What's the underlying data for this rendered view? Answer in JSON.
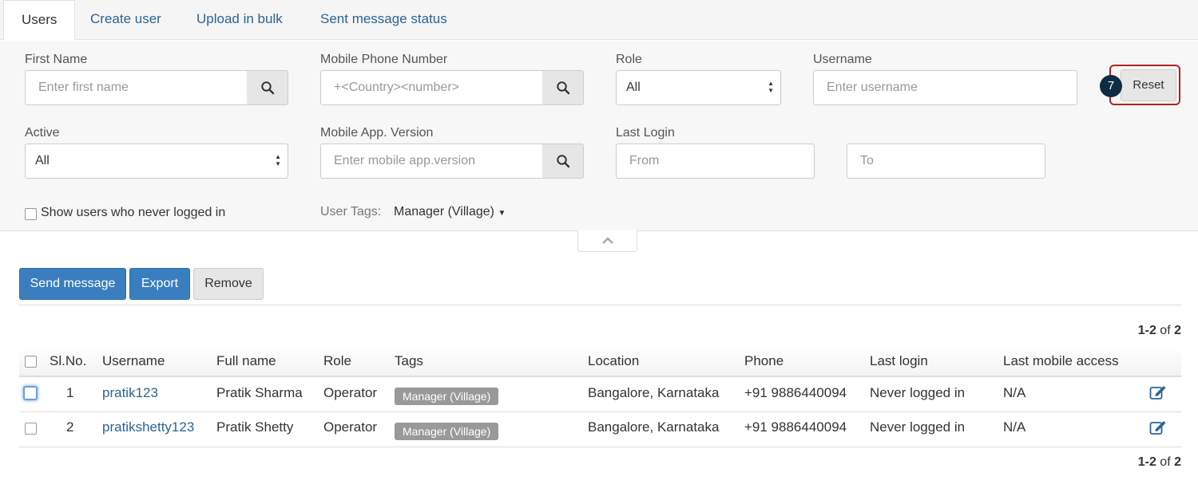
{
  "tabs": [
    {
      "label": "Users",
      "active": true
    },
    {
      "label": "Create user",
      "active": false
    },
    {
      "label": "Upload in bulk",
      "active": false
    },
    {
      "label": "Sent message status",
      "active": false
    }
  ],
  "filters": {
    "first_name": {
      "label": "First Name",
      "placeholder": "Enter first name"
    },
    "mobile_phone": {
      "label": "Mobile Phone Number",
      "placeholder": "+<Country><number>"
    },
    "role": {
      "label": "Role",
      "value": "All"
    },
    "username": {
      "label": "Username",
      "placeholder": "Enter username"
    },
    "reset_label": "Reset",
    "step_badge": "7",
    "active": {
      "label": "Active",
      "value": "All"
    },
    "app_version": {
      "label": "Mobile App. Version",
      "placeholder": "Enter mobile app.version"
    },
    "last_login": {
      "label": "Last Login",
      "from_placeholder": "From",
      "to_placeholder": "To"
    },
    "never_logged_label": "Show users who never logged in",
    "user_tags_label": "User Tags:",
    "user_tags_value": "Manager (Village)"
  },
  "actions": {
    "send_message": "Send message",
    "export": "Export",
    "remove": "Remove"
  },
  "pagination": {
    "range": "1-2",
    "of": "of",
    "total": "2"
  },
  "table": {
    "columns": [
      "Sl.No.",
      "Username",
      "Full name",
      "Role",
      "Tags",
      "Location",
      "Phone",
      "Last login",
      "Last mobile access"
    ],
    "rows": [
      {
        "sl": "1",
        "username": "pratik123",
        "full_name": "Pratik Sharma",
        "role": "Operator",
        "tag": "Manager (Village)",
        "location": "Bangalore, Karnataka",
        "phone": "+91 9886440094",
        "last_login": "Never logged in",
        "last_mobile_access": "N/A"
      },
      {
        "sl": "2",
        "username": "pratikshetty123",
        "full_name": "Pratik Shetty",
        "role": "Operator",
        "tag": "Manager (Village)",
        "location": "Bangalore, Karnataka",
        "phone": "+91 9886440094",
        "last_login": "Never logged in",
        "last_mobile_access": "N/A"
      }
    ]
  },
  "colors": {
    "primary": "#3a7ebf",
    "link": "#2a6496",
    "highlight_border": "#b22222",
    "badge_bg": "#0d2d44",
    "tag_bg": "#999999"
  },
  "icons": {
    "search": "search-icon",
    "collapse": "chevron-up-icon",
    "edit": "edit-icon",
    "dropdown": "caret-down-icon"
  }
}
